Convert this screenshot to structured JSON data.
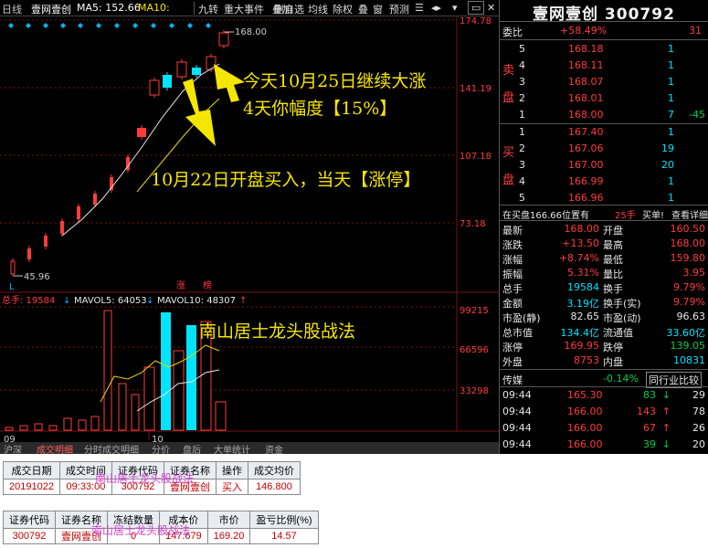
{
  "toolbar": {
    "period": "日线",
    "stock": "壹网壹创",
    "ma5_label": "MA5: 152.66",
    "ma10_label": "MA10:",
    "buttons": [
      "九转",
      "重大事件",
      "叠加",
      "删自选",
      "均线",
      "除权",
      "叠",
      "窗",
      "预测"
    ]
  },
  "chart": {
    "price_ticks": [
      "174.78",
      "141.19",
      "107.18",
      "73.18"
    ],
    "high_label": "168.00",
    "low_label": "45.96",
    "marker_labels": [
      "涨",
      "榜"
    ],
    "month_labels": [
      "09",
      "10"
    ],
    "vol_header": {
      "total": "总手: 19584",
      "mavol5": "MAVOL5: 64053",
      "mavol10": "MAVOL10: 48307"
    },
    "vol_ticks": [
      "99215",
      "66596",
      "33298"
    ],
    "annotations": {
      "a1_line1": "今天10月25日继续大涨",
      "a1_line2": "4天你幅度【15%】",
      "a2": "10月22日开盘买入，当天【涨停】",
      "a3": "南山居士龙头股战法"
    },
    "l_marker": "L"
  },
  "tabs": [
    "沪深",
    "成交明细",
    "分时成交明细",
    "分价",
    "盘后",
    "大单统计",
    "资金"
  ],
  "quote": {
    "name": "壹网壹创",
    "code": "300792",
    "weibi_label": "委比",
    "weibi": "+58.49%",
    "weibi_diff": "31",
    "sell_side_chars": [
      "卖",
      "盘"
    ],
    "buy_side_chars": [
      "买",
      "盘"
    ],
    "sell": [
      {
        "lvl": "5",
        "price": "168.18",
        "vol": "1",
        "chg": ""
      },
      {
        "lvl": "4",
        "price": "168.11",
        "vol": "1",
        "chg": ""
      },
      {
        "lvl": "3",
        "price": "168.07",
        "vol": "1",
        "chg": ""
      },
      {
        "lvl": "2",
        "price": "168.01",
        "vol": "1",
        "chg": ""
      },
      {
        "lvl": "1",
        "price": "168.00",
        "vol": "7",
        "chg": "-45"
      }
    ],
    "buy": [
      {
        "lvl": "1",
        "price": "167.40",
        "vol": "1"
      },
      {
        "lvl": "2",
        "price": "167.06",
        "vol": "19"
      },
      {
        "lvl": "3",
        "price": "167.00",
        "vol": "20"
      },
      {
        "lvl": "4",
        "price": "166.99",
        "vol": "1"
      },
      {
        "lvl": "5",
        "price": "166.96",
        "vol": "1"
      }
    ],
    "order_bar": {
      "text": "在买盘166.66位置有",
      "qty": "25手",
      "action": "买单!",
      "detail": "查看详细"
    },
    "stats": [
      [
        "最新",
        "168.00",
        "开盘",
        "160.50"
      ],
      [
        "涨跌",
        "+13.50",
        "最高",
        "168.00"
      ],
      [
        "涨幅",
        "+8.74%",
        "最低",
        "159.80"
      ],
      [
        "振幅",
        "5.31%",
        "量比",
        "3.95"
      ],
      [
        "总手",
        "19584",
        "换手",
        "9.79%"
      ],
      [
        "金额",
        "3.19亿",
        "换手(实)",
        "9.79%"
      ],
      [
        "市盈(静)",
        "82.65",
        "市盈(动)",
        "96.63"
      ],
      [
        "总市值",
        "134.4亿",
        "流通值",
        "33.60亿"
      ],
      [
        "涨停",
        "169.95",
        "跌停",
        "139.05"
      ],
      [
        "外盘",
        "8753",
        "内盘",
        "10831"
      ]
    ],
    "industry": {
      "name": "传媒",
      "pct": "-0.14%",
      "btn": "同行业比较"
    },
    "ticks": [
      {
        "time": "09:44",
        "price": "165.30",
        "vol": "83",
        "dir": "down",
        "n": "29"
      },
      {
        "time": "09:44",
        "price": "166.00",
        "vol": "143",
        "dir": "up",
        "n": "78"
      },
      {
        "time": "09:44",
        "price": "166.00",
        "vol": "67",
        "dir": "up",
        "n": "26"
      },
      {
        "time": "09:44",
        "price": "166.00",
        "vol": "39",
        "dir": "down",
        "n": "20"
      }
    ]
  },
  "trade_table": {
    "headers": [
      "成交日期",
      "成交时间",
      "证券代码",
      "证券名称",
      "操作",
      "成交均价"
    ],
    "row": [
      "20191022",
      "09:33:00",
      "300792",
      "壹网壹创",
      "买入",
      "146.800"
    ],
    "watermark": "南山居士龙头股战法"
  },
  "hold_table": {
    "headers": [
      "证券代码",
      "证券名称",
      "冻结数量",
      "成本价",
      "市价",
      "盈亏比例(%)"
    ],
    "row": [
      "300792",
      "壹网壹创",
      "0",
      "147.679",
      "169.20",
      "14.57"
    ],
    "watermark": "南山居士龙头股战法"
  },
  "colors": {
    "up": "#ff3c3c",
    "down": "#00e4ff",
    "accent": "#f5e600",
    "bg": "#000000"
  }
}
